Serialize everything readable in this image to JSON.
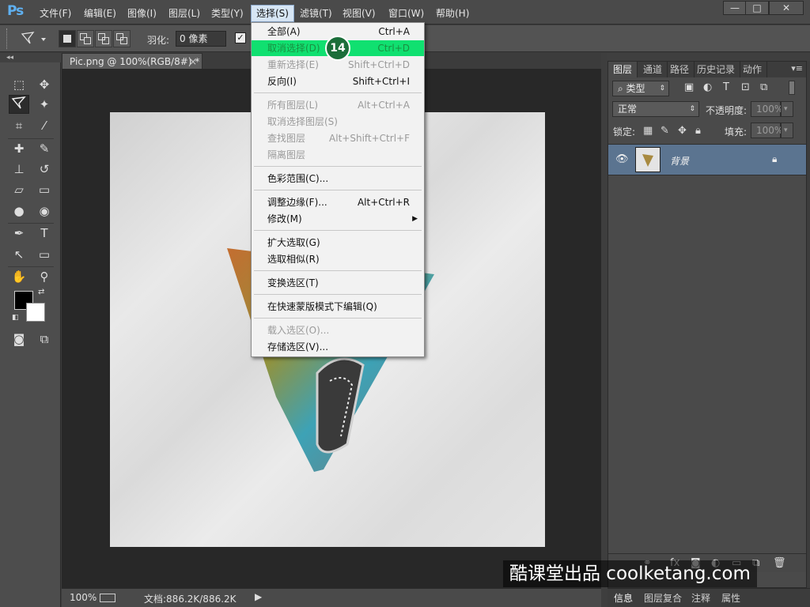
{
  "app": {
    "logo": "Ps"
  },
  "menubar": {
    "items": [
      "文件(F)",
      "编辑(E)",
      "图像(I)",
      "图层(L)",
      "类型(Y)",
      "选择(S)",
      "滤镜(T)",
      "视图(V)",
      "窗口(W)",
      "帮助(H)"
    ],
    "active_index": 5
  },
  "window_controls": {
    "minimize": "—",
    "maximize": "□",
    "close": "✕"
  },
  "options_bar": {
    "feather_label": "羽化:",
    "feather_value": "0 像素",
    "checkbox_checked": "✓"
  },
  "document": {
    "tab_title": "Pic.png @ 100%(RGB/8#) *",
    "tab_close": "×"
  },
  "status_bar": {
    "zoom": "100%",
    "doc_info": "文档:886.2K/886.2K",
    "arrow": "▶"
  },
  "select_menu": {
    "items": [
      {
        "label": "全部(A)",
        "shortcut": "Ctrl+A",
        "disabled": false
      },
      {
        "label": "取消选择(D)",
        "shortcut": "Ctrl+D",
        "disabled": true,
        "highlighted": true
      },
      {
        "label": "重新选择(E)",
        "shortcut": "Shift+Ctrl+D",
        "disabled": true
      },
      {
        "label": "反向(I)",
        "shortcut": "Shift+Ctrl+I",
        "disabled": false
      },
      {
        "label": "所有图层(L)",
        "shortcut": "Alt+Ctrl+A",
        "disabled": true
      },
      {
        "label": "取消选择图层(S)",
        "shortcut": "",
        "disabled": true
      },
      {
        "label": "查找图层",
        "shortcut": "Alt+Shift+Ctrl+F",
        "disabled": true
      },
      {
        "label": "隔离图层",
        "shortcut": "",
        "disabled": true
      },
      {
        "label": "色彩范围(C)...",
        "shortcut": "",
        "disabled": false
      },
      {
        "label": "调整边缘(F)...",
        "shortcut": "Alt+Ctrl+R",
        "disabled": false
      },
      {
        "label": "修改(M)",
        "shortcut": "",
        "disabled": false,
        "submenu": true
      },
      {
        "label": "扩大选取(G)",
        "shortcut": "",
        "disabled": false
      },
      {
        "label": "选取相似(R)",
        "shortcut": "",
        "disabled": false
      },
      {
        "label": "变换选区(T)",
        "shortcut": "",
        "disabled": false
      },
      {
        "label": "在快速蒙版模式下编辑(Q)",
        "shortcut": "",
        "disabled": false
      },
      {
        "label": "载入选区(O)...",
        "shortcut": "",
        "disabled": true
      },
      {
        "label": "存储选区(V)...",
        "shortcut": "",
        "disabled": false
      }
    ],
    "step_badge": "14"
  },
  "layers_panel": {
    "tabs": [
      "图层",
      "通道",
      "路径",
      "历史记录",
      "动作"
    ],
    "filter_kind": "类型",
    "blend_mode": "正常",
    "opacity_label": "不透明度:",
    "opacity_value": "100%",
    "lock_label": "锁定:",
    "fill_label": "填充:",
    "fill_value": "100%",
    "layer_name": "背景"
  },
  "bottom_tabs": [
    "信息",
    "图层复合",
    "注释",
    "属性"
  ],
  "watermark": "酷课堂出品 coolketang.com"
}
